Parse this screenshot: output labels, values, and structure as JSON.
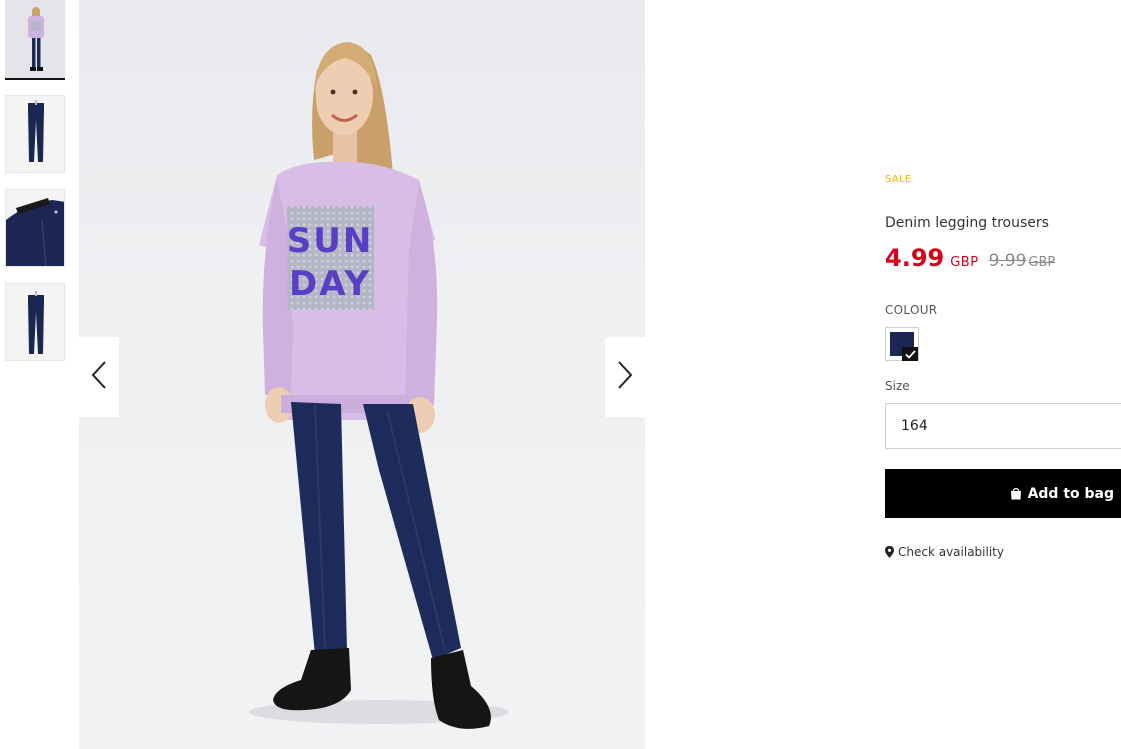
{
  "gallery": {
    "thumbnails": [
      {
        "alt": "model-wearing-trousers"
      },
      {
        "alt": "trousers-front"
      },
      {
        "alt": "trousers-detail"
      },
      {
        "alt": "trousers-back"
      }
    ],
    "main_image_print": "SUN DAY",
    "prev_icon": "chevron-left-icon",
    "next_icon": "chevron-right-icon"
  },
  "product": {
    "badge": "SALE",
    "title": "Denim legging trousers",
    "price_new": "4.99",
    "currency_new": "GBP",
    "price_old": "9.99",
    "currency_old": "GBP",
    "colour_label": "COLOUR",
    "selected_colour": "#1b2652",
    "size_label": "Size",
    "size_value": "164",
    "add_to_bag": "Add to bag",
    "add_to_bag_icon": "shopping-bag-icon",
    "check_availability": "Check availability",
    "check_availability_icon": "map-pin-icon"
  },
  "colors": {
    "sale_badge": "#f0b400",
    "price_new": "#d6001c",
    "price_old": "#8a8a8a",
    "button_bg": "#000000"
  }
}
